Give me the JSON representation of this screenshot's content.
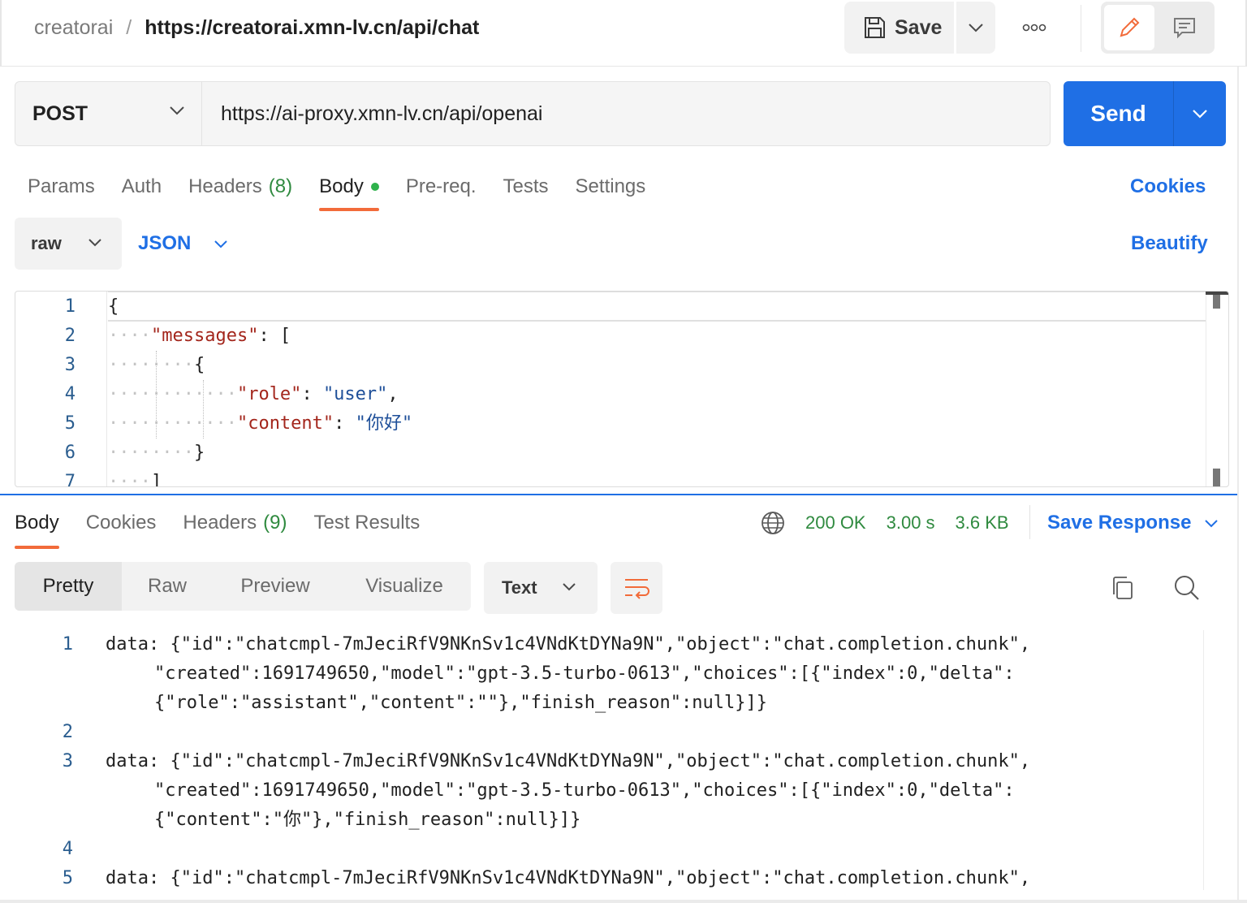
{
  "header": {
    "workspace": "creatorai",
    "separator": "/",
    "request_name": "https://creatorai.xmn-lv.cn/api/chat",
    "save_label": "Save"
  },
  "request": {
    "method": "POST",
    "url": "https://ai-proxy.xmn-lv.cn/api/openai",
    "send_label": "Send"
  },
  "request_tabs": {
    "params": "Params",
    "auth": "Auth",
    "headers": "Headers",
    "headers_count": "(8)",
    "body": "Body",
    "prereq": "Pre-req.",
    "tests": "Tests",
    "settings": "Settings",
    "cookies": "Cookies"
  },
  "body_options": {
    "mode": "raw",
    "language": "JSON",
    "beautify": "Beautify"
  },
  "editor": {
    "line_numbers": [
      "1",
      "2",
      "3",
      "4",
      "5",
      "6",
      "7"
    ],
    "l1": "{",
    "l2_key": "\"messages\"",
    "l2_rest": ": [",
    "l3": "{",
    "l4_key": "\"role\"",
    "l4_colon": ": ",
    "l4_val": "\"user\"",
    "l4_end": ",",
    "l5_key": "\"content\"",
    "l5_colon": ": ",
    "l5_val": "\"你好\"",
    "l6": "}",
    "l7": "]"
  },
  "response_tabs": {
    "body": "Body",
    "cookies": "Cookies",
    "headers": "Headers",
    "headers_count": "(9)",
    "test_results": "Test Results"
  },
  "response_status": {
    "status": "200 OK",
    "time": "3.00 s",
    "size": "3.6 KB",
    "save_response": "Save Response"
  },
  "response_view": {
    "pretty": "Pretty",
    "raw": "Raw",
    "preview": "Preview",
    "visualize": "Visualize",
    "format": "Text"
  },
  "response_body": {
    "line_numbers": [
      "1",
      "2",
      "3",
      "4",
      "5"
    ],
    "l1a": "data: {\"id\":\"chatcmpl-7mJeciRfV9NKnSv1c4VNdKtDYNa9N\",\"object\":\"chat.completion.chunk\",",
    "l1b": "\"created\":1691749650,\"model\":\"gpt-3.5-turbo-0613\",\"choices\":[{\"index\":0,\"delta\":",
    "l1c": "{\"role\":\"assistant\",\"content\":\"\"},\"finish_reason\":null}]}",
    "l3a": "data: {\"id\":\"chatcmpl-7mJeciRfV9NKnSv1c4VNdKtDYNa9N\",\"object\":\"chat.completion.chunk\",",
    "l3b": "\"created\":1691749650,\"model\":\"gpt-3.5-turbo-0613\",\"choices\":[{\"index\":0,\"delta\":",
    "l3c": "{\"content\":\"你\"},\"finish_reason\":null}]}",
    "l5a": "data: {\"id\":\"chatcmpl-7mJeciRfV9NKnSv1c4VNdKtDYNa9N\",\"object\":\"chat.completion.chunk\","
  },
  "colors": {
    "accent_blue": "#1f6fe5",
    "active_tab_underline": "#f26b3a",
    "status_green": "#2f8a3f",
    "body_dot": "#2fb24c"
  },
  "icons": [
    "save-icon",
    "chevron-down-icon",
    "more-icon",
    "edit-pencil-icon",
    "comment-icon",
    "globe-icon",
    "wrap-lines-icon",
    "copy-icon",
    "search-icon"
  ]
}
